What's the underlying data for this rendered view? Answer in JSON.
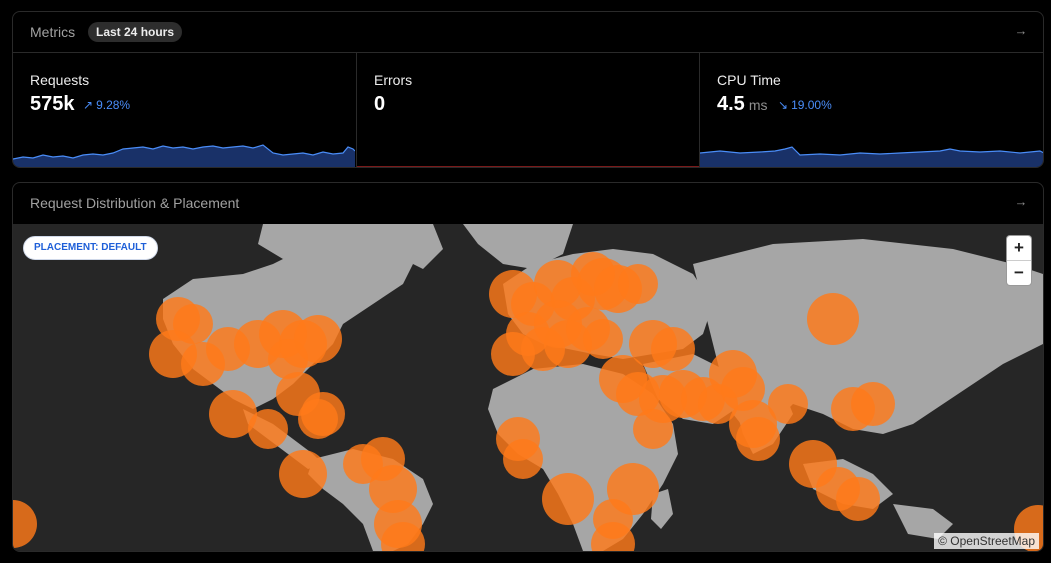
{
  "metrics": {
    "title": "Metrics",
    "range_badge": "Last 24 hours",
    "open_icon": "arrow-right-icon",
    "cards": [
      {
        "label": "Requests",
        "value": "575k",
        "unit": "",
        "trend": "9.28%",
        "trend_dir": "up",
        "trend_icon": "trend-up-icon"
      },
      {
        "label": "Errors",
        "value": "0",
        "unit": "",
        "trend": "",
        "trend_dir": "",
        "trend_icon": ""
      },
      {
        "label": "CPU Time",
        "value": "4.5",
        "unit": "ms",
        "trend": "19.00%",
        "trend_dir": "down",
        "trend_icon": "trend-down-icon"
      }
    ],
    "colors": {
      "accent": "#4a8df8",
      "spark_fill": "#1d3a7a",
      "error_line": "#7a1a1a"
    }
  },
  "distribution": {
    "title": "Request Distribution & Placement",
    "open_icon": "arrow-right-icon",
    "placement_badge": "PLACEMENT: DEFAULT",
    "zoom_in": "+",
    "zoom_out": "−",
    "attribution": "© OpenStreetMap",
    "colors": {
      "ocean": "#262626",
      "land": "#a6a6a6",
      "marker": "#ff7a1a"
    }
  }
}
